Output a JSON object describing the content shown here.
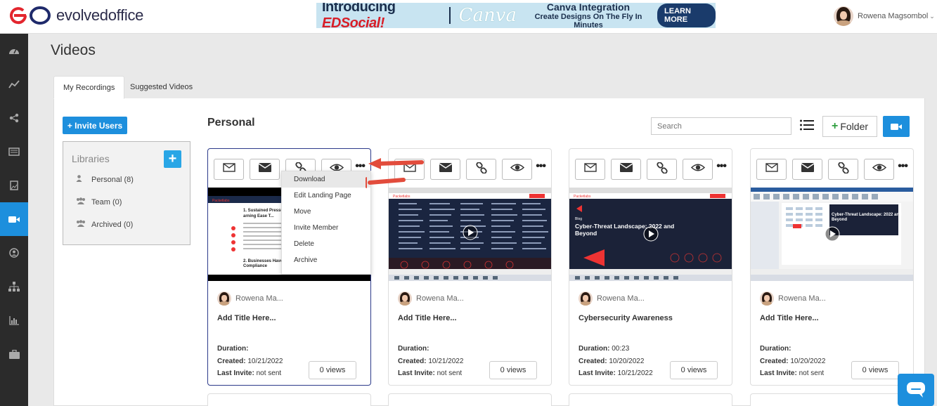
{
  "app": {
    "logo_text": "evolvedoffice",
    "brand_color": "#e3262e",
    "accent_color": "#1d8fdd"
  },
  "banner": {
    "intro": "Introducing",
    "product": "EDSocial!",
    "partner": "Canva",
    "headline": "Canva Integration",
    "subline": "Create Designs On The Fly In Minutes",
    "cta": "LEARN MORE"
  },
  "user": {
    "name": "Rowena Magsombol"
  },
  "sidebar": {
    "items": [
      "dashboard-icon",
      "analytics-icon",
      "share-icon",
      "newsletter-icon",
      "image-icon",
      "video-icon",
      "contacts-icon",
      "org-chart-icon",
      "reports-icon",
      "briefcase-icon"
    ],
    "active": "video-icon"
  },
  "page": {
    "title": "Videos"
  },
  "tabs": [
    {
      "label": "My Recordings",
      "active": true
    },
    {
      "label": "Suggested Videos",
      "active": false
    }
  ],
  "invite_button": "+ Invite Users",
  "libraries": {
    "title": "Libraries",
    "add": "+",
    "items": [
      {
        "label": "Personal (8)",
        "icon": "user-icon"
      },
      {
        "label": "Team (0)",
        "icon": "users-icon"
      },
      {
        "label": "Archived (0)",
        "icon": "users-icon"
      }
    ]
  },
  "section": {
    "title": "Personal"
  },
  "search": {
    "placeholder": "Search"
  },
  "folder_button": "Folder",
  "context_menu": {
    "items": [
      "Download",
      "Edit Landing Page",
      "Move",
      "Invite Member",
      "Delete",
      "Archive"
    ],
    "highlighted": "Download"
  },
  "cards": [
    {
      "owner": "Rowena Ma...",
      "title": "Add Title Here...",
      "duration": "",
      "created": "10/21/2022",
      "last_invite": "not sent",
      "views": "0 views",
      "thumb": "article"
    },
    {
      "owner": "Rowena Ma...",
      "title": "Add Title Here...",
      "duration": "",
      "created": "10/21/2022",
      "last_invite": "not sent",
      "views": "0 views",
      "thumb": "site"
    },
    {
      "owner": "Rowena Ma...",
      "title": "Cybersecurity Awareness",
      "duration": "00:23",
      "created": "10/20/2022",
      "last_invite": "10/21/2022",
      "views": "0 views",
      "thumb": "blog"
    },
    {
      "owner": "Rowena Ma...",
      "title": "Add Title Here...",
      "duration": "",
      "created": "10/20/2022",
      "last_invite": "not sent",
      "views": "0 views",
      "thumb": "doc"
    }
  ],
  "labels": {
    "duration": "Duration:",
    "created": "Created:",
    "last_invite": "Last Invite:"
  },
  "thumb_text": {
    "article_h1": "1. Sustained Pressure On Machine Learning Ease T...",
    "article_h2": "2. Businesses Have Increa... Compliance",
    "blog_tag": "Blog",
    "blog_title": "Cyber-Threat Landscape: 2022 and Beyond",
    "doc_title": "Cyber-Threat Landscape: 2022 and Beyond"
  }
}
